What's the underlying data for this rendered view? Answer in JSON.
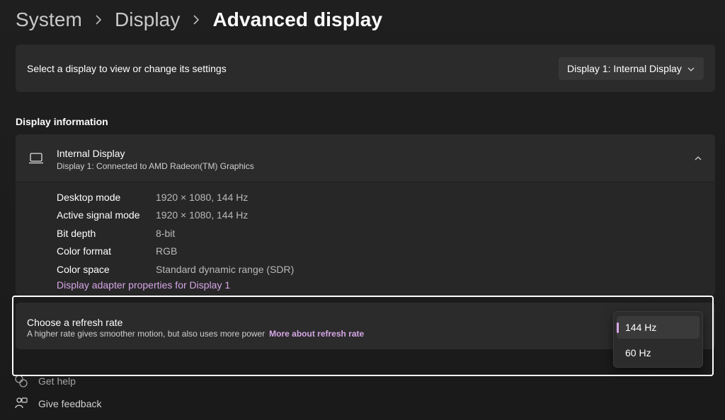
{
  "breadcrumb": {
    "items": [
      "System",
      "Display",
      "Advanced display"
    ]
  },
  "select_display": {
    "label": "Select a display to view or change its settings",
    "dropdown_value": "Display 1: Internal Display"
  },
  "display_information": {
    "section_title": "Display information",
    "display_name": "Internal Display",
    "display_subtitle": "Display 1: Connected to AMD Radeon(TM) Graphics",
    "rows": [
      {
        "key": "Desktop mode",
        "value": "1920 × 1080, 144 Hz"
      },
      {
        "key": "Active signal mode",
        "value": "1920 × 1080, 144 Hz"
      },
      {
        "key": "Bit depth",
        "value": "8-bit"
      },
      {
        "key": "Color format",
        "value": "RGB"
      },
      {
        "key": "Color space",
        "value": "Standard dynamic range (SDR)"
      }
    ],
    "adapter_link": "Display adapter properties for Display 1"
  },
  "refresh_rate": {
    "title": "Choose a refresh rate",
    "description": "A higher rate gives smoother motion, but also uses more power",
    "link": "More about refresh rate",
    "options": [
      "144 Hz",
      "60 Hz"
    ],
    "selected": "144 Hz"
  },
  "footer": {
    "get_help": "Get help",
    "give_feedback": "Give feedback"
  },
  "colors": {
    "accent": "#d6a6e6",
    "background": "#202020",
    "card": "#2b2b2b"
  }
}
